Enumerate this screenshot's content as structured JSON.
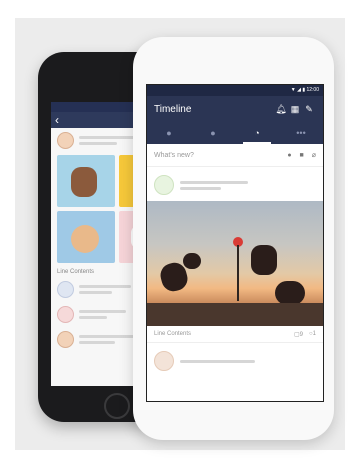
{
  "back_app": {
    "back_arrow": "‹",
    "section_label": "Line Contents"
  },
  "front_app": {
    "status_text": "▼ ◢ ▮ 12:00",
    "header": {
      "title": "Timeline"
    },
    "tabs": [
      {
        "icon": "person-icon",
        "glyph": "●"
      },
      {
        "icon": "chat-icon",
        "glyph": "●"
      },
      {
        "icon": "timeline-icon",
        "glyph": "◔"
      },
      {
        "icon": "more-icon",
        "glyph": "•••"
      }
    ],
    "compose": {
      "placeholder": "What's new?"
    },
    "post": {
      "source": "Line Contents",
      "likes": "▢9",
      "comments": "○1"
    }
  },
  "colors": {
    "header": "#2b3554",
    "status": "#1f2844",
    "back_phone": "#1b1b1d"
  }
}
